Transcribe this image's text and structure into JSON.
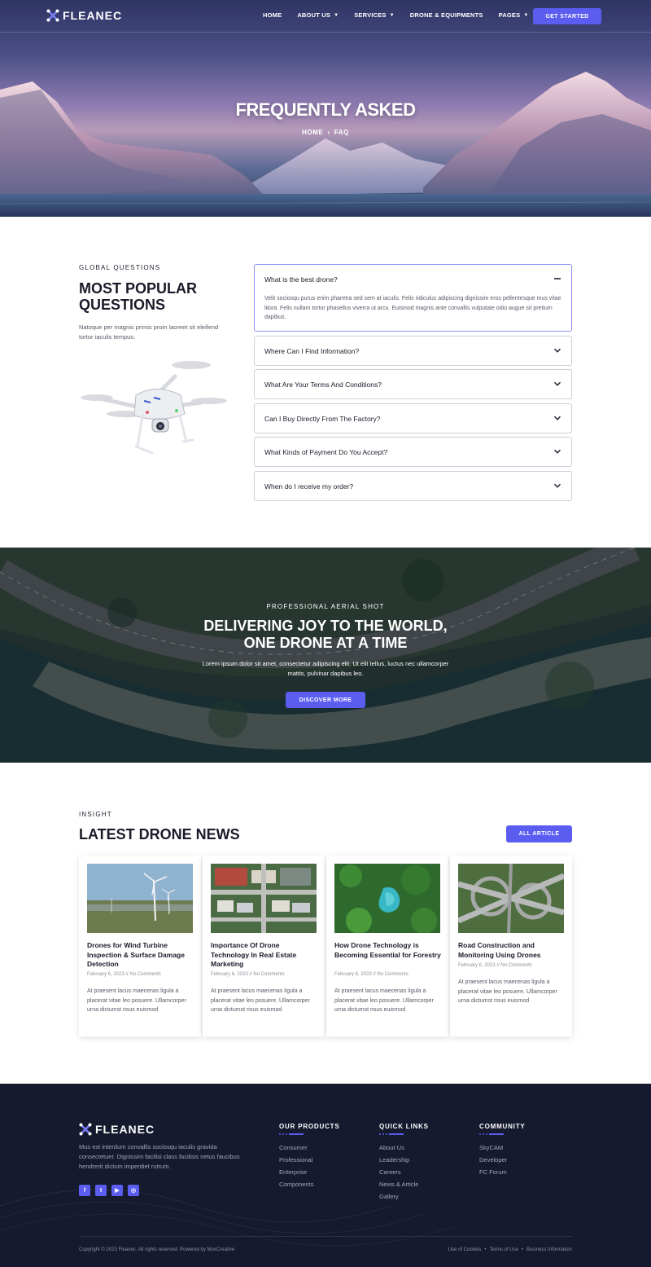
{
  "brand": {
    "name": "FLEANEC",
    "accent": "#5a5df0"
  },
  "nav": {
    "items": [
      {
        "label": "HOME",
        "dropdown": false
      },
      {
        "label": "ABOUT US",
        "dropdown": true
      },
      {
        "label": "SERVICES",
        "dropdown": true
      },
      {
        "label": "DRONE & EQUIPMENTS",
        "dropdown": false
      },
      {
        "label": "PAGES",
        "dropdown": true
      }
    ],
    "cta": "GET STARTED"
  },
  "hero": {
    "title": "FREQUENTLY ASKED",
    "breadcrumb": {
      "home": "HOME",
      "separator": "›",
      "current": "FAQ"
    }
  },
  "faq": {
    "eyebrow": "GLOBAL QUESTIONS",
    "title": "MOST POPULAR QUESTIONS",
    "description": "Natoque per magnis primis proin laoreet sit eleifend tortor iaculis tempus.",
    "items": [
      {
        "question": "What is the best drone?",
        "open": true,
        "answer": "Velit sociosqu purus enim pharetra sed sem at iaculis. Felis ridiculus adipiscing dignissim eros pellentesque mus vitae litora. Felis nullam tortor phasellus viverra ut arcu. Euismod magnis ante convallis vulputate odio augue sit pretium dapibus."
      },
      {
        "question": "Where Can I Find Information?",
        "open": false
      },
      {
        "question": "What Are Your Terms And Conditions?",
        "open": false
      },
      {
        "question": "Can I Buy Directly From The Factory?",
        "open": false
      },
      {
        "question": "What Kinds of Payment Do You Accept?",
        "open": false
      },
      {
        "question": "When do I receive my order?",
        "open": false
      }
    ]
  },
  "promo": {
    "eyebrow": "PROFESSIONAL AERIAL SHOT",
    "title": "DELIVERING JOY TO THE WORLD, ONE DRONE AT A TIME",
    "text": "Lorem ipsum dolor sit amet, consectetur adipiscing elit. Ut elit tellus, luctus nec ullamcorper mattis, pulvinar dapibus leo.",
    "button": "DISCOVER MORE"
  },
  "news": {
    "eyebrow": "INSIGHT",
    "title": "LATEST DRONE NEWS",
    "button": "ALL ARTICLE",
    "posts": [
      {
        "title": "Drones for Wind Turbine Inspection & Surface Damage Detection",
        "date": "February 6, 2023",
        "separator": "//",
        "comments": "No Comments",
        "excerpt": "At praesent lacus maecenas ligula a placerat vitae leo posuere. Ullamcorper urna dictumst risus euismod"
      },
      {
        "title": "Importance Of Drone Technology In Real Estate Marketing",
        "date": "February 6, 2023",
        "separator": "//",
        "comments": "No Comments",
        "excerpt": "At praesent lacus maecenas ligula a placerat vitae leo posuere. Ullamcorper urna dictumst risus euismod"
      },
      {
        "title": "How Drone Technology is Becoming Essential for Forestry",
        "date": "February 6, 2023",
        "separator": "//",
        "comments": "No Comments",
        "excerpt": "At praesent lacus maecenas ligula a placerat vitae leo posuere. Ullamcorper urna dictumst risus euismod"
      },
      {
        "title": "Road Construction and Monitoring Using Drones",
        "date": "February 6, 2023",
        "separator": "//",
        "comments": "No Comments",
        "excerpt": "At praesent lacus maecenas ligula a placerat vitae leo posuere. Ullamcorper urna dictumst risus euismod"
      }
    ]
  },
  "footer": {
    "description": "Mus est interdum convallis sociosqu iaculis gravida consectetuer. Dignissim facilisi class facilisis netus faucibus hendrerit dictum imperdiet rutrum.",
    "socials": [
      {
        "icon": "facebook-icon",
        "glyph": "f"
      },
      {
        "icon": "twitter-icon",
        "glyph": "t"
      },
      {
        "icon": "youtube-icon",
        "glyph": "▶"
      },
      {
        "icon": "instagram-icon",
        "glyph": "◎"
      }
    ],
    "columns": [
      {
        "title": "OUR PRODUCTS",
        "links": [
          "Consumer",
          "Professional",
          "Enterprise",
          "Components"
        ]
      },
      {
        "title": "QUICK LINKS",
        "links": [
          "About Us",
          "Leadership",
          "Careers",
          "News & Article",
          "Gallery"
        ]
      },
      {
        "title": "COMMUNITY",
        "links": [
          "SkyCAM",
          "Developer",
          "FC Forum"
        ]
      }
    ],
    "copyright": "Copyright © 2023 Fleanec. All rights reserved. Powered by MoxCreative",
    "legal": [
      "Use of Cookies",
      "Terms of Use",
      "Business Information"
    ],
    "legal_separator": "•"
  }
}
